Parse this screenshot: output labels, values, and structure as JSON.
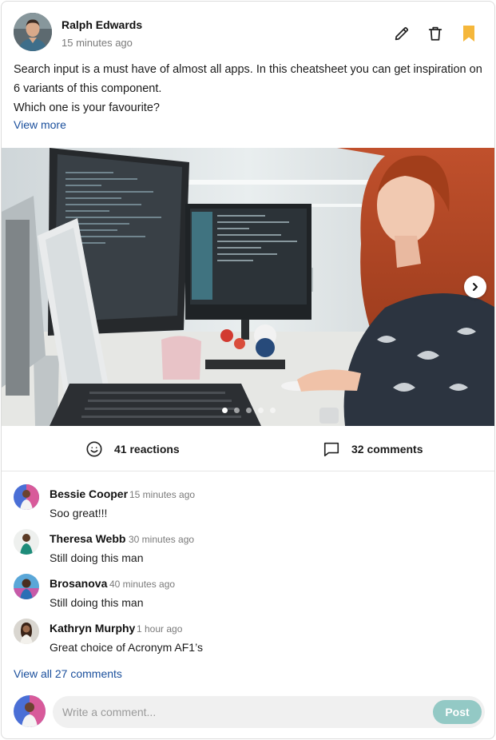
{
  "post": {
    "author": "Ralph Edwards",
    "time": "15 minutes ago",
    "text_line1": "Search input is a must have of almost all apps. In this cheatsheet you can get inspiration on 6 variants of this component.",
    "text_line2": "Which one is your favourite?",
    "view_more": "View more",
    "bookmark_color": "#F5B73B",
    "link_color": "#1A4F9C"
  },
  "carousel": {
    "slide_count": 5,
    "active_index": 0
  },
  "stats": {
    "reactions": "41 reactions",
    "comments": "32 comments"
  },
  "comments": [
    {
      "name": "Bessie Cooper",
      "time": "15 minutes ago",
      "text": "Soo great!!!"
    },
    {
      "name": "Theresa Webb",
      "time": "30 minutes ago",
      "text": "Still doing this man"
    },
    {
      "name": "Brosanova",
      "time": "40 minutes ago",
      "text": "Still doing this man"
    },
    {
      "name": "Kathryn Murphy",
      "time": "1 hour ago",
      "text": "Great choice of Acronym AF1’s"
    }
  ],
  "view_all": "View all 27 comments",
  "composer": {
    "placeholder": "Write a comment...",
    "post_label": "Post",
    "post_color": "#93C9C5"
  }
}
